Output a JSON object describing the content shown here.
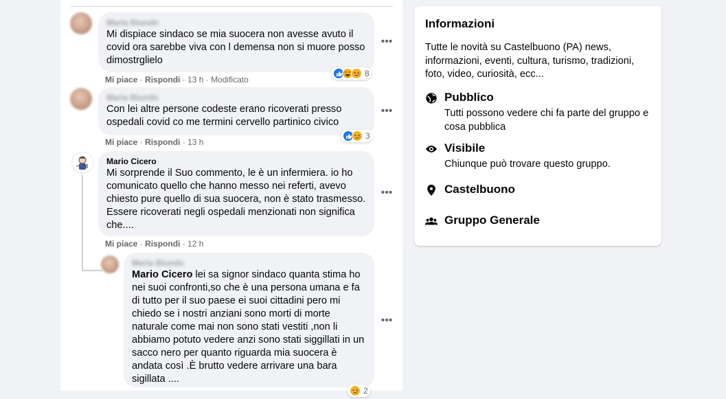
{
  "comments": [
    {
      "author": "Maria Biundo",
      "text": "Mi dispiace sindaco se mia suocera non avesse avuto il covid ora sarebbe viva con l demensa non si muore posso dimostrglielo",
      "like": "Mi piace",
      "reply": "Rispondi",
      "time": "13 h",
      "edited": "Modificato",
      "reactions_count": "8",
      "reaction_icons": [
        "like-icon",
        "haha-icon",
        "sad-icon"
      ]
    },
    {
      "author": "Maria Biundo",
      "text": "Con lei altre persone codeste erano ricoverati presso ospedali covid co me termini cervello partinico civico",
      "like": "Mi piace",
      "reply": "Rispondi",
      "time": "13 h",
      "reactions_count": "3",
      "reaction_icons": [
        "like-icon",
        "sad-icon"
      ]
    },
    {
      "author": "Mario Cicero",
      "text": "Mi sorprende il Suo commento, le è un infermiera. io ho comunicato quello che hanno messo nei referti, avevo chiesto pure quello di sua suocera, non è stato trasmesso. Essere ricoverati negli ospedali menzionati non significa che....",
      "like": "Mi piace",
      "reply": "Rispondi",
      "time": "12 h"
    },
    {
      "author": "Maria Biundo",
      "mention": "Mario Cicero",
      "text": "lei sa signor sindaco quanta stima ho nei suoi confronti,so che è una persona umana e fa di tutto per il suo paese ei suoi cittadini pero mi chiedo se i nostri anziani sono morti di morte naturale come mai non sono stati vestiti ,non li abbiamo potuto vedere anzi sono stati siggillati in un sacco nero per quanto riguarda mia suocera è andata così .È brutto vedere arrivare una bara sigillata ....",
      "reactions_count": "2",
      "reaction_icons": [
        "sad-icon"
      ]
    }
  ],
  "more_options_glyph": "•••",
  "sidebar": {
    "title": "Informazioni",
    "description": "Tutte le novità su Castelbuono (PA) news, informazioni, eventi, cultura, turismo, tradizioni, foto, video, curiosità, ecc...",
    "privacy_title": "Pubblico",
    "privacy_text": "Tutti possono vedere chi fa parte del gruppo e cosa pubblica",
    "visibility_title": "Visibile",
    "visibility_text": "Chiunque può trovare questo gruppo.",
    "location": "Castelbuono",
    "category": "Gruppo Generale"
  },
  "colors": {
    "background": "#f0f2f5",
    "card": "#ffffff",
    "bubble": "#f0f2f5",
    "meta_text": "#65676b",
    "like_blue": "#1877f2",
    "reaction_yellow": "#f7b125"
  }
}
